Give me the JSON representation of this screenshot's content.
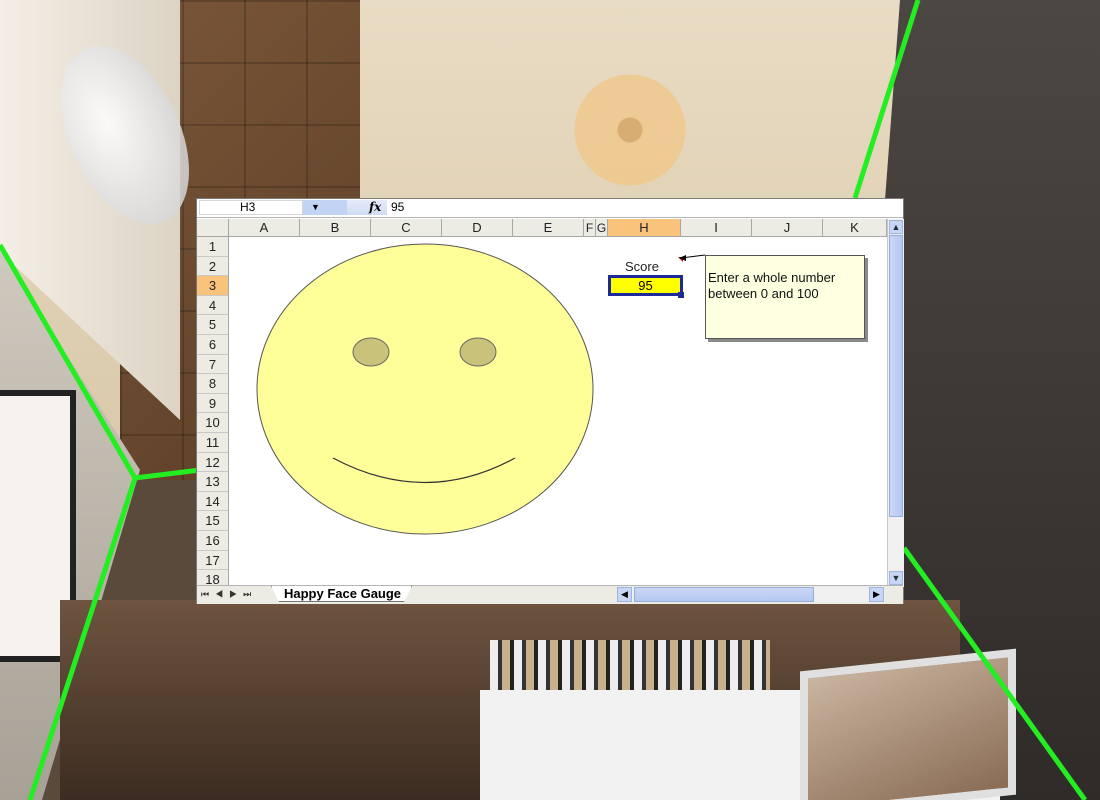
{
  "window": {
    "name_box": "H3",
    "fx_symbol": "fx",
    "formula_value": "95",
    "name_dropdown": "▼"
  },
  "columns": [
    "A",
    "B",
    "C",
    "D",
    "E",
    "F",
    "G",
    "H",
    "I",
    "J",
    "K"
  ],
  "selected_column": "H",
  "rows": [
    "1",
    "2",
    "3",
    "4",
    "5",
    "6",
    "7",
    "8",
    "9",
    "10",
    "11",
    "12",
    "13",
    "14",
    "15",
    "16",
    "17",
    "18"
  ],
  "selected_row": "3",
  "score": {
    "label": "Score",
    "value": "95"
  },
  "comment": {
    "text": "Enter a whole number between 0 and 100"
  },
  "sheet_tabs": [
    "Happy Face Gauge"
  ],
  "nav_buttons": "⏮◀▶⏭",
  "scroll": {
    "up": "▲",
    "down": "▼",
    "left": "◀",
    "right": "▶"
  },
  "colors": {
    "face_fill": "#ffff99",
    "eye_fill": "#c8c27a",
    "score_fill": "#ffff00",
    "selection_border": "#1e2a9a",
    "header_selected": "#f9c37c",
    "comment_fill": "#ffffe1",
    "frame_green": "#22ee22"
  },
  "icons": {
    "fx": "function-icon",
    "dropdown": "chevron-down-icon"
  }
}
